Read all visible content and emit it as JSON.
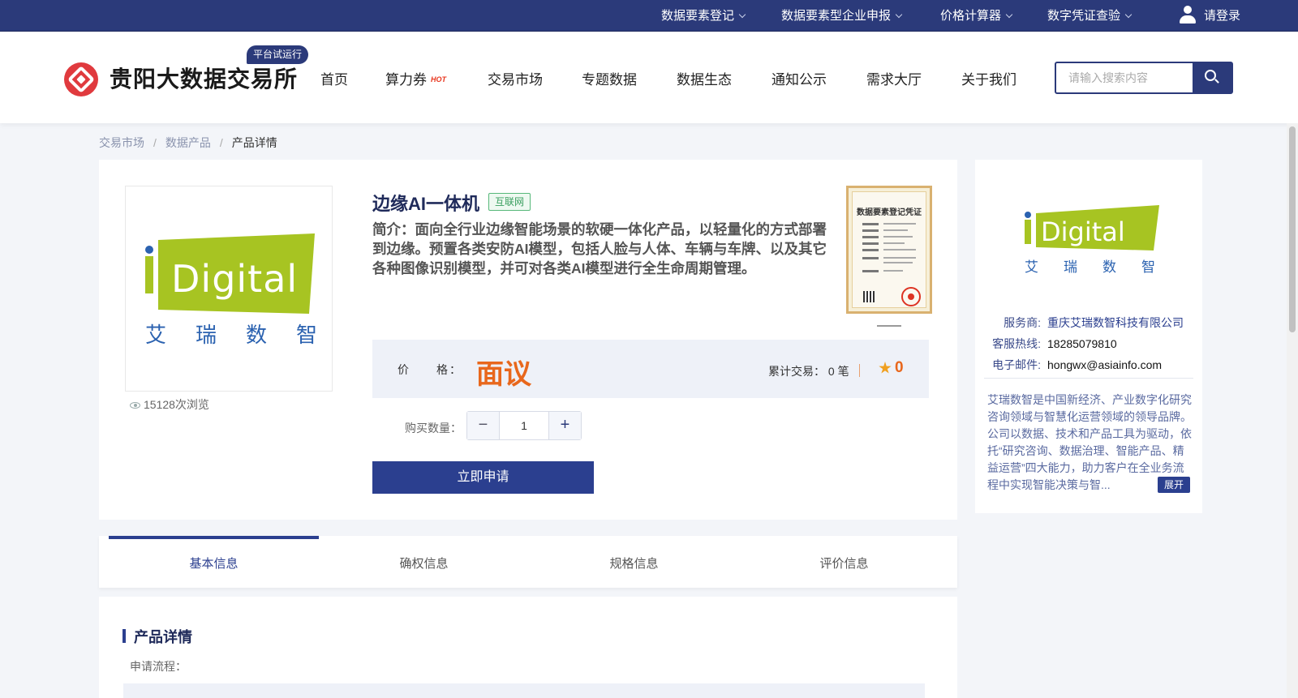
{
  "topbar": {
    "items": [
      {
        "label": "数据要素登记"
      },
      {
        "label": "数据要素型企业申报"
      },
      {
        "label": "价格计算器"
      },
      {
        "label": "数字凭证查验"
      }
    ],
    "login_label": "请登录",
    "background": "#2b3a7a"
  },
  "header": {
    "site_name": "贵阳大数据交易所",
    "trial_badge": "平台试运行",
    "nav": [
      "首页",
      "算力券",
      "交易市场",
      "专题数据",
      "数据生态",
      "通知公示",
      "需求大厅",
      "关于我们"
    ],
    "hot_tag": "HOT",
    "search_placeholder": "请输入搜索内容"
  },
  "breadcrumb": [
    "交易市场",
    "数据产品",
    "产品详情"
  ],
  "product": {
    "title": "边缘AI一体机",
    "tag": "互联网",
    "description": "简介：面向全行业边缘智能场景的软硬一体化产品，以轻量化的方式部署到边缘。预置各类安防AI模型，包括人脸与人体、车辆与车牌、以及其它各种图像识别模型，并可对各类AI模型进行全生命周期管理。",
    "views": "15128次浏览",
    "logo": {
      "brand": "Digital",
      "chinese": [
        "艾",
        "瑞",
        "数",
        "智"
      ],
      "color": "#a7c422",
      "text_color": "#2b62b0"
    },
    "certificate_title": "数据要素登记凭证",
    "price_label": "价　　格：",
    "price_value": "面议",
    "trades_label": "累计交易：",
    "trades_value": "0 笔",
    "rating": "0",
    "qty_label": "购买数量：",
    "qty_value": "1",
    "apply_label": "立即申请",
    "accent": "#e8671c"
  },
  "vendor": {
    "provider_label": "服务商:",
    "provider_value": "重庆艾瑞数智科技有限公司",
    "hotline_label": "客服热线:",
    "hotline_value": "18285079810",
    "email_label": "电子邮件:",
    "email_value": "hongwx@asiainfo.com",
    "description": "艾瑞数智是中国新经济、产业数字化研究咨询领域与智慧化运营领域的领导品牌。公司以数据、技术和产品工具为驱动，依托“研究咨询、数据治理、智能产品、精益运营”四大能力，助力客户在全业务流程中实现智能决策与智...",
    "expand_label": "展开"
  },
  "tabs": [
    {
      "label": "基本信息",
      "active": true
    },
    {
      "label": "确权信息",
      "active": false
    },
    {
      "label": "规格信息",
      "active": false
    },
    {
      "label": "评价信息",
      "active": false
    }
  ],
  "detail": {
    "section_title": "产品详情",
    "flow_label": "申请流程："
  }
}
